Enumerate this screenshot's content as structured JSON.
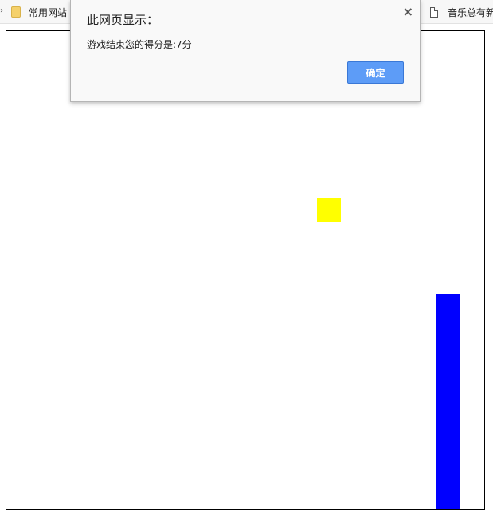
{
  "bookmarks_bar": {
    "arrow_icon": "chevron-right-icon",
    "items": [
      {
        "label": "常用网站",
        "icon": "folder-icon"
      },
      {
        "label": "音乐总有新",
        "icon": "page-icon"
      }
    ]
  },
  "dialog": {
    "title": "此网页显示：",
    "close_symbol": "×",
    "message": "游戏结束您的得分是:7分",
    "ok_label": "确定"
  },
  "game": {
    "food_color": "#ffff00",
    "paddle_color": "#0000ff",
    "border_color": "#000000"
  }
}
